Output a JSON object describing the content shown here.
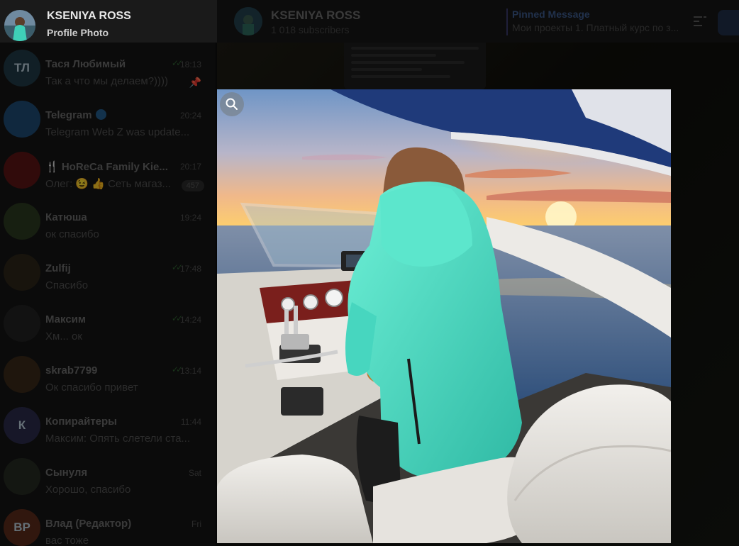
{
  "profile": {
    "name": "KSENIYA ROSS",
    "subtitle": "Profile Photo"
  },
  "header": {
    "channel_name": "KSENIYA ROSS",
    "subscribers": "1 018 subscribers",
    "pinned_label": "Pinned Message",
    "pinned_text": "Мои проекты 1. Платный курс по з..."
  },
  "chats": [
    {
      "initials": "ТЛ",
      "name": "Тася Любимый",
      "preview": "Так а что мы делаем?))))",
      "time": "18:13",
      "read": true,
      "pinned": true,
      "avatar_color": "#1f3a45"
    },
    {
      "initials": "",
      "name": "Telegram",
      "preview": "Telegram Web Z was update...",
      "time": "20:24",
      "verified": true,
      "avatar_color": "#1e4a72"
    },
    {
      "initials": "",
      "name": "🍴 HoReCa Family Kie...",
      "preview": "Олег: 😉 👍 Сеть магаз...",
      "time": "20:17",
      "badge": "457",
      "avatar_color": "#5a1414"
    },
    {
      "initials": "",
      "name": "Катюша",
      "preview": "ок спасибо",
      "time": "19:24",
      "avatar_color": "#2a3a20"
    },
    {
      "initials": "",
      "name": "Zulfij",
      "preview": "Спасибо",
      "time": "17:48",
      "read": true,
      "avatar_color": "#2d2618"
    },
    {
      "initials": "",
      "name": "Максим",
      "preview": "Хм... ок",
      "time": "14:24",
      "read": true,
      "avatar_color": "#222"
    },
    {
      "initials": "",
      "name": "skrab7799",
      "preview": "Ок спасибо привет",
      "time": "13:14",
      "read": true,
      "avatar_color": "#3a2818"
    },
    {
      "initials": "К",
      "name": "Копирайтеры",
      "preview": "Максим: Опять слетели ста...",
      "time": "11:44",
      "avatar_color": "#2a2a4a"
    },
    {
      "initials": "",
      "name": "Сынуля",
      "preview": "Хорошо, спасибо",
      "time": "Sat",
      "avatar_color": "#262a22"
    },
    {
      "initials": "ВР",
      "name": "Влад (Редактор)",
      "preview": "вас тоже",
      "time": "Fri",
      "avatar_color": "#5a2a1a"
    }
  ],
  "icons": {
    "zoom": "search-icon",
    "filter": "filter-icon"
  }
}
